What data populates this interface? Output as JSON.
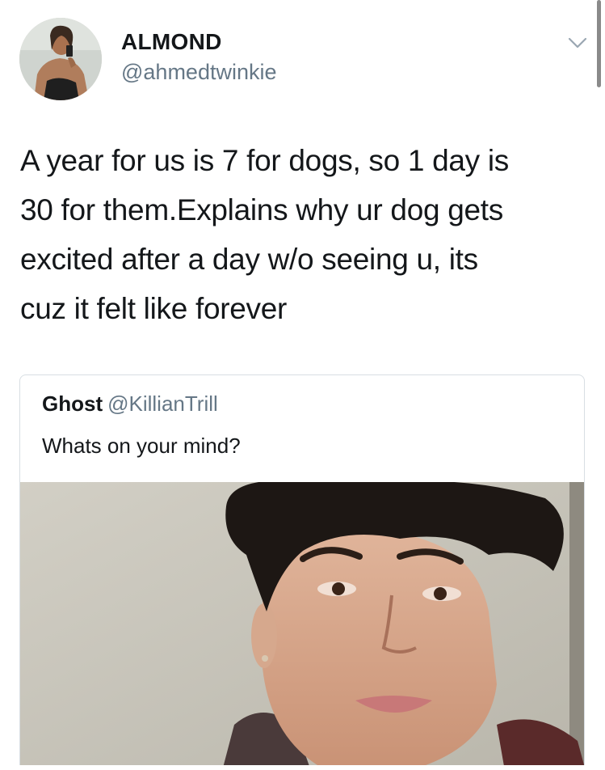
{
  "tweet": {
    "author_name": "ALMOND",
    "author_handle": "@ahmedtwinkie",
    "text": "A year for us is 7 for dogs, so 1 day is\n30 for them.Explains why ur dog gets\nexcited after a day w/o seeing u, its\ncuz it felt like forever",
    "menu_icon": "chevron-down-icon"
  },
  "quoted_tweet": {
    "author_name": "Ghost",
    "author_handle": "@KillianTrill",
    "text": "Whats on your mind?"
  },
  "colors": {
    "text_primary": "#14171a",
    "text_secondary": "#657786",
    "border": "#d8dee3"
  }
}
